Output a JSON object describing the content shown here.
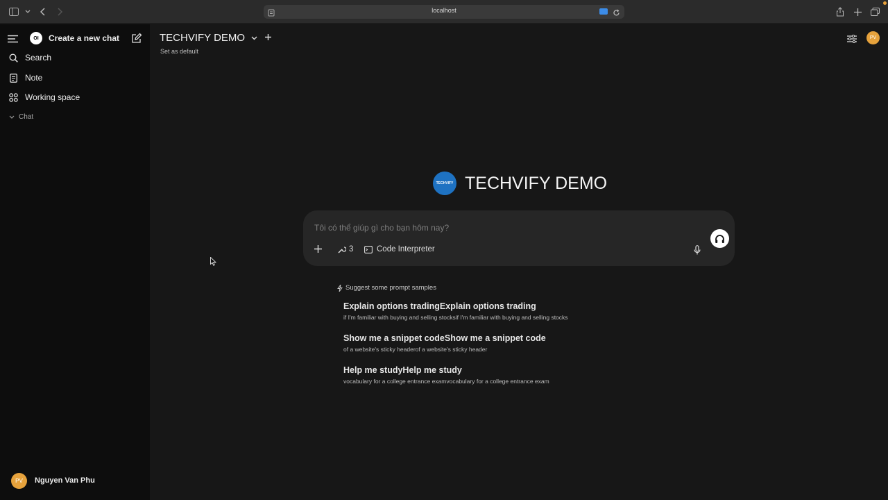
{
  "browser": {
    "url": "localhost"
  },
  "sidebar": {
    "new_chat_label": "Create a new chat",
    "logo_text": "OI",
    "items": [
      {
        "label": "Search",
        "icon": "search-icon"
      },
      {
        "label": "Note",
        "icon": "note-icon"
      },
      {
        "label": "Working space",
        "icon": "workspace-icon"
      }
    ],
    "chat_section_label": "Chat",
    "user": {
      "name": "Nguyen Van Phu",
      "initials": "PV"
    }
  },
  "header": {
    "model_name": "TECHVIFY DEMO",
    "set_default_label": "Set as default",
    "user_initials": "PV"
  },
  "hero": {
    "logo_text": "TECHVIFY",
    "title": "TECHVIFY DEMO"
  },
  "composer": {
    "placeholder": "Tôi có thể giúp gì cho bạn hôm nay?",
    "tools_count": "3",
    "code_interpreter_label": "Code Interpreter"
  },
  "suggestions": {
    "heading": "Suggest some prompt samples",
    "items": [
      {
        "title": "Explain options tradingExplain options trading",
        "subtitle": "if I'm familiar with buying and selling stocksif I'm familiar with buying and selling stocks"
      },
      {
        "title": "Show me a snippet codeShow me a snippet code",
        "subtitle": "of a website's sticky headerof a website's sticky header"
      },
      {
        "title": "Help me studyHelp me study",
        "subtitle": "vocabulary for a college entrance examvocabulary for a college entrance exam"
      }
    ]
  },
  "colors": {
    "avatar": "#e6a23c",
    "hero_logo": "#1e72c2",
    "sidebar_bg": "#0d0d0d",
    "main_bg": "#171717"
  }
}
